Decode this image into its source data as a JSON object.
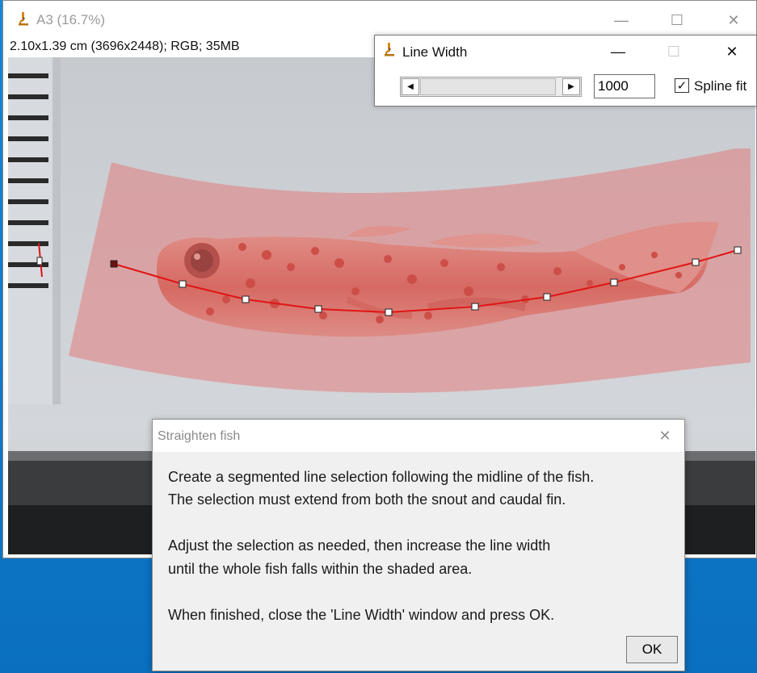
{
  "image_window": {
    "title": "A3 (16.7%)",
    "info": "2.10x1.39 cm (3696x2448); RGB; 35MB",
    "controls": {
      "minimize": "—",
      "maximize": "☐",
      "close": "✕"
    }
  },
  "line_width": {
    "title": "Line Width",
    "value": "1000",
    "spline_fit_label": "Spline fit",
    "spline_fit_checked": "✓",
    "controls": {
      "minimize": "—",
      "maximize": "☐",
      "close": "✕"
    },
    "scroll_left": "◀",
    "scroll_right": "▶"
  },
  "straighten_dialog": {
    "title": "Straighten fish",
    "close": "✕",
    "lines": [
      "Create a segmented line selection following the midline of the fish.",
      "The selection must extend from both the snout and caudal fin.",
      "Adjust the selection as needed, then increase the line width",
      "until the whole fish falls within the shaded area.",
      "When finished, close the 'Line Width' window and press OK."
    ],
    "ok_label": "OK"
  },
  "colors": {
    "selection_line": "#e01515",
    "selection_band": "#e66b6b",
    "accent_window_bg": "#1487d6"
  },
  "icons": {
    "app_icon": "microscope-icon",
    "checkbox": "checkmark-icon"
  }
}
